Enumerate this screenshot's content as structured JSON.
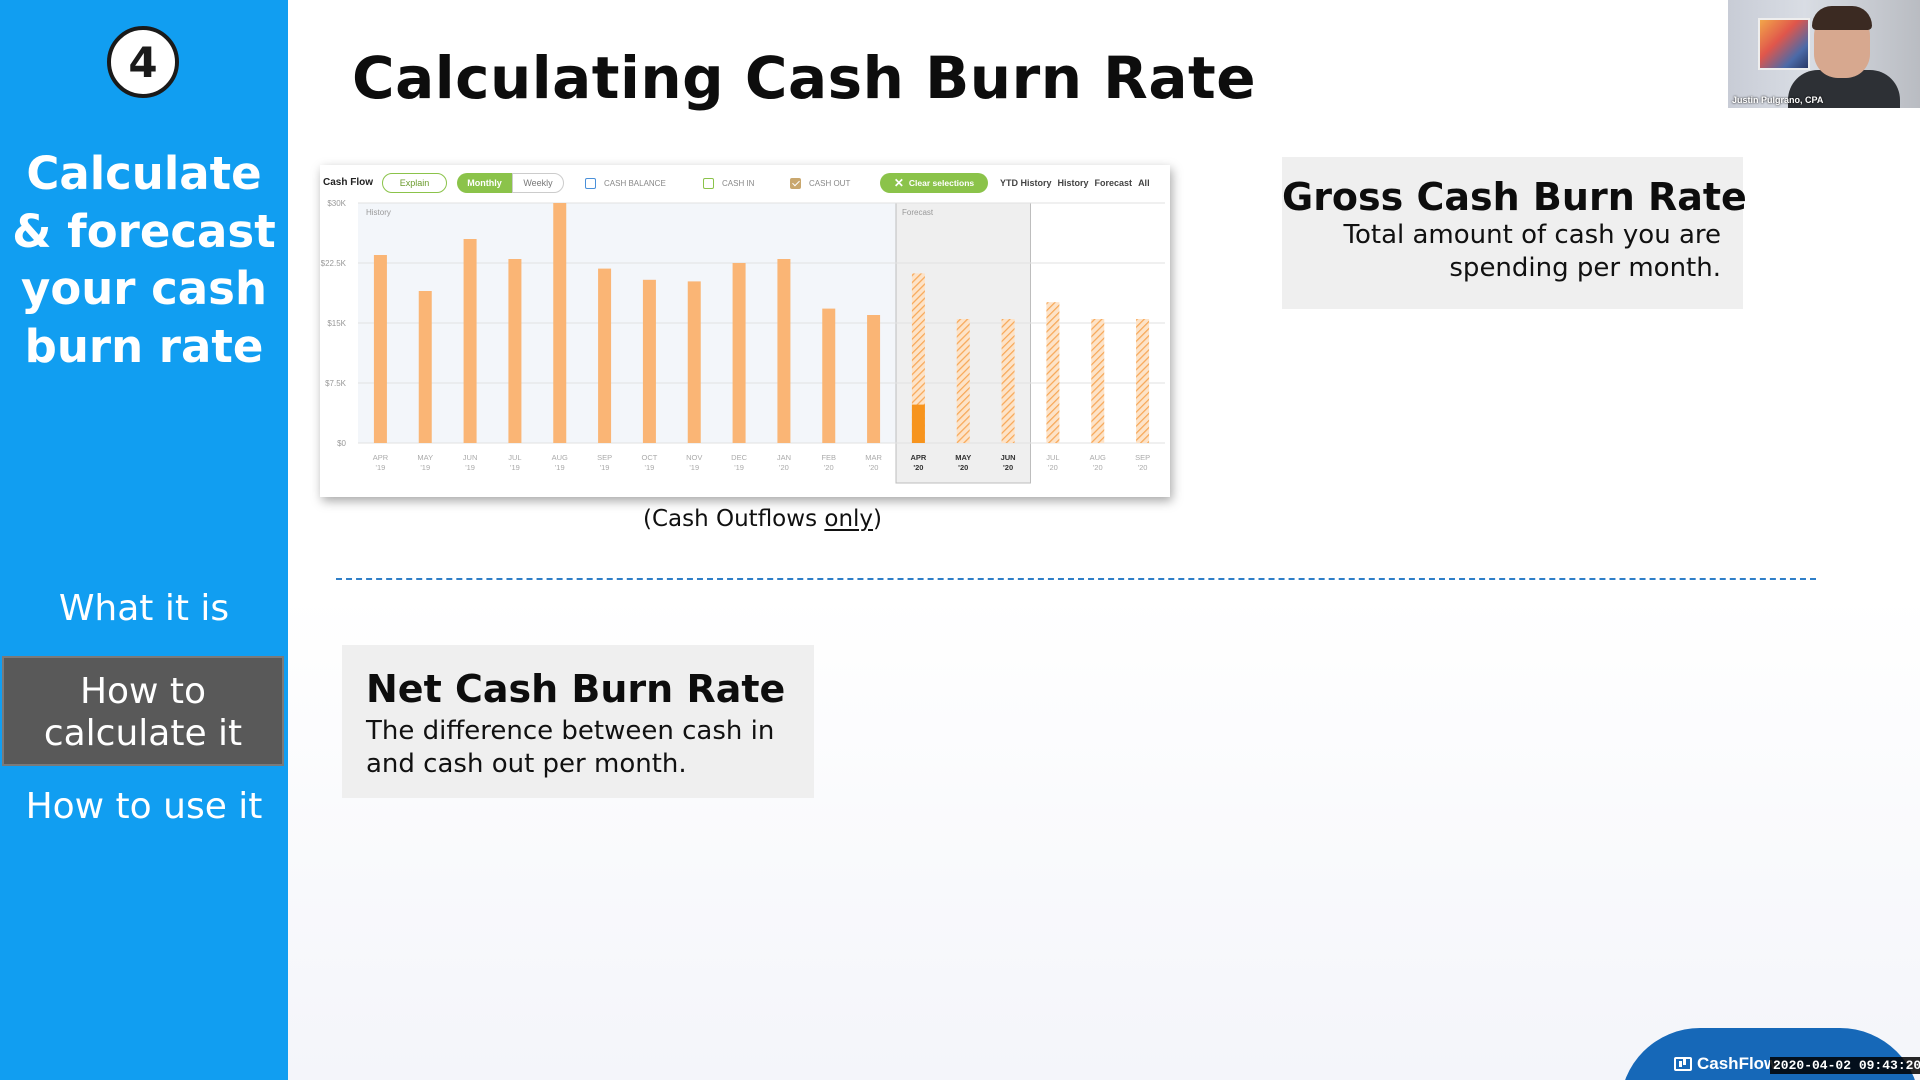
{
  "sidebar": {
    "step_number": "4",
    "title": "Calculate & forecast your cash burn rate",
    "nav": [
      {
        "label": "What it is"
      },
      {
        "label": "How to calculate it",
        "selected": true
      },
      {
        "label": "How to use it"
      }
    ],
    "accent": "#119ef1",
    "selected_bg": "#595959"
  },
  "slide": {
    "title": "Calculating Cash Burn Rate",
    "caption_prefix": "(Cash Outflows ",
    "caption_underlined": "only",
    "caption_suffix": ")",
    "gross": {
      "title": "Gross Cash Burn Rate",
      "text": "Total amount of cash you are spending per month."
    },
    "net": {
      "title": "Net Cash Burn Rate",
      "text": "The difference between cash in and cash out per month."
    }
  },
  "chart_toolbar": {
    "title": "Cash Flow",
    "explain": "Explain",
    "monthly": "Monthly",
    "weekly": "Weekly",
    "cash_balance": "CASH BALANCE",
    "cash_in": "CASH IN",
    "cash_out": "CASH OUT",
    "clear": "Clear selections",
    "views": [
      "YTD History",
      "History",
      "Forecast",
      "All"
    ]
  },
  "chart_data": {
    "type": "bar",
    "categories": [
      "APR '19",
      "MAY '19",
      "JUN '19",
      "JUL '19",
      "AUG '19",
      "SEP '19",
      "OCT '19",
      "NOV '19",
      "DEC '19",
      "JAN '20",
      "FEB '20",
      "MAR '20",
      "APR '20",
      "MAY '20",
      "JUN '20",
      "JUL '20",
      "AUG '20",
      "SEP '20"
    ],
    "tick_month": [
      "APR",
      "MAY",
      "JUN",
      "JUL",
      "AUG",
      "SEP",
      "OCT",
      "NOV",
      "DEC",
      "JAN",
      "FEB",
      "MAR",
      "APR",
      "MAY",
      "JUN",
      "JUL",
      "AUG",
      "SEP"
    ],
    "tick_year": [
      "'19",
      "'19",
      "'19",
      "'19",
      "'19",
      "'19",
      "'19",
      "'19",
      "'19",
      "'20",
      "'20",
      "'20",
      "'20",
      "'20",
      "'20",
      "'20",
      "'20",
      "'20"
    ],
    "series": [
      {
        "name": "CASH OUT",
        "values": [
          23500,
          19000,
          25500,
          23000,
          30000,
          21800,
          20400,
          20200,
          22500,
          23000,
          16800,
          16000,
          21200,
          15500,
          15500,
          17600,
          15500,
          15500
        ]
      }
    ],
    "actual_portion_index": 12,
    "actual_portion_value": 4800,
    "forecast_start_index": 12,
    "highlighted_indices": [
      12,
      13,
      14
    ],
    "region_labels": {
      "history": "History",
      "forecast": "Forecast"
    },
    "ylim": [
      0,
      30000
    ],
    "yticks": [
      0,
      7500,
      15000,
      22500,
      30000
    ],
    "ytick_labels": [
      "$0",
      "$7.5K",
      "$15K",
      "$22.5K",
      "$30K"
    ],
    "bar_color": "#fab575",
    "actual_color": "#f7941d",
    "grid": true
  },
  "webcam": {
    "name": "Justin Pulgrano, CPA"
  },
  "footer": {
    "logo_text": "CashFlow",
    "timestamp": "2020-04-02 09:43:20"
  }
}
